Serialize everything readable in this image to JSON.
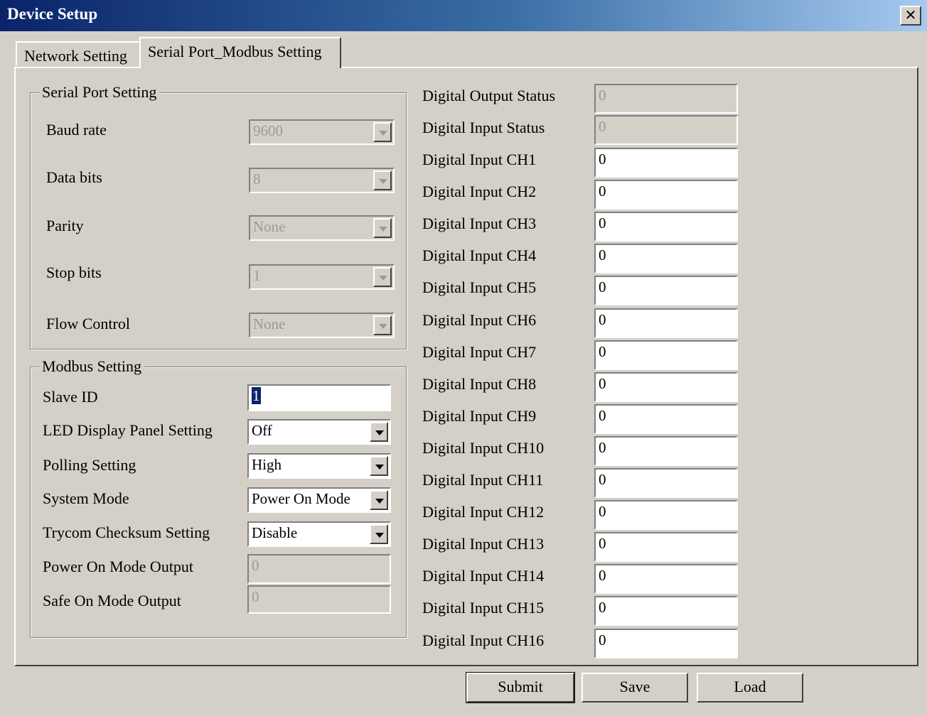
{
  "window": {
    "title": "Device Setup",
    "close_glyph": "✕"
  },
  "tabs": [
    {
      "label": "Network Setting"
    },
    {
      "label": "Serial Port_Modbus Setting"
    }
  ],
  "serial": {
    "group_title": "Serial Port Setting",
    "baud_label": "Baud rate",
    "baud_value": "9600",
    "databits_label": "Data bits",
    "databits_value": "8",
    "parity_label": "Parity",
    "parity_value": "None",
    "stopbits_label": "Stop bits",
    "stopbits_value": "1",
    "flow_label": "Flow Control",
    "flow_value": "None"
  },
  "modbus": {
    "group_title": "Modbus Setting",
    "slave_label": "Slave ID",
    "slave_value": "1",
    "led_label": "LED Display Panel Setting",
    "led_value": "Off",
    "polling_label": "Polling  Setting",
    "polling_value": "High",
    "mode_label": "System Mode",
    "mode_value": "Power On Mode",
    "checksum_label": "Trycom Checksum Setting",
    "checksum_value": "Disable",
    "poweron_label": "Power On Mode Output",
    "poweron_value": "0",
    "safeon_label": "Safe On Mode Output",
    "safeon_value": "0"
  },
  "status": {
    "output_label": "Digital Output Status",
    "output_value": "0",
    "input_label": "Digital Input Status",
    "input_value": "0",
    "channels": [
      {
        "label": "Digital Input CH1",
        "value": "0"
      },
      {
        "label": "Digital Input CH2",
        "value": "0"
      },
      {
        "label": "Digital Input CH3",
        "value": "0"
      },
      {
        "label": "Digital Input CH4",
        "value": "0"
      },
      {
        "label": "Digital Input CH5",
        "value": "0"
      },
      {
        "label": "Digital Input CH6",
        "value": "0"
      },
      {
        "label": "Digital Input CH7",
        "value": "0"
      },
      {
        "label": "Digital Input CH8",
        "value": "0"
      },
      {
        "label": "Digital Input CH9",
        "value": "0"
      },
      {
        "label": "Digital Input CH10",
        "value": "0"
      },
      {
        "label": "Digital Input CH11",
        "value": "0"
      },
      {
        "label": "Digital Input CH12",
        "value": "0"
      },
      {
        "label": "Digital Input CH13",
        "value": "0"
      },
      {
        "label": "Digital Input CH14",
        "value": "0"
      },
      {
        "label": "Digital Input CH15",
        "value": "0"
      },
      {
        "label": "Digital Input CH16",
        "value": "0"
      }
    ]
  },
  "buttons": {
    "submit": "Submit",
    "save": "Save",
    "load": "Load"
  }
}
